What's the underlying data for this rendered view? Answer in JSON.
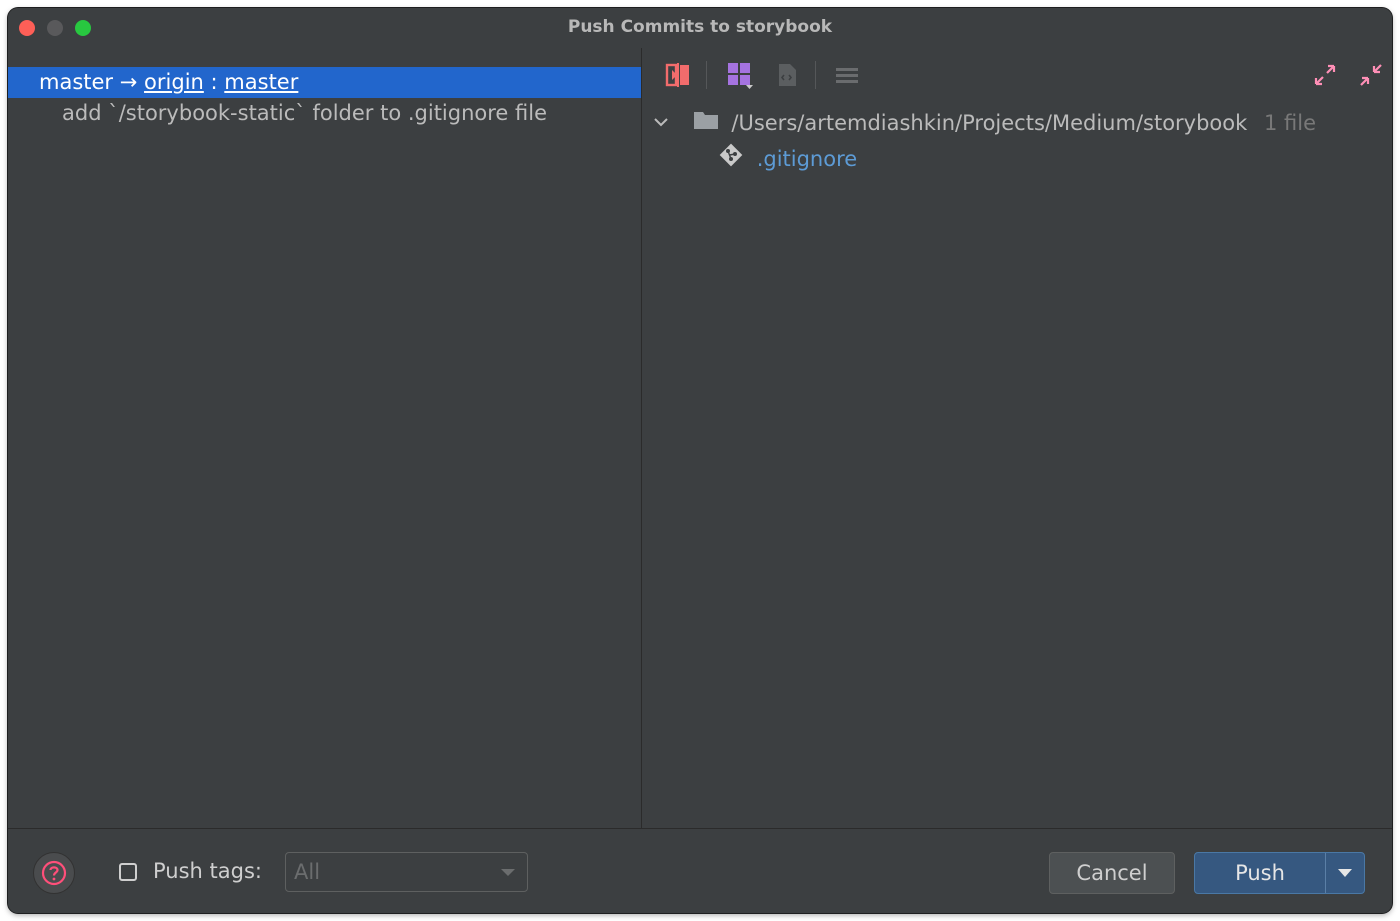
{
  "window": {
    "title": "Push Commits to storybook"
  },
  "branch": {
    "local": "master",
    "arrow": "→",
    "remote": "origin",
    "separator": ":",
    "remote_branch": "master"
  },
  "commits": [
    {
      "message": "add `/storybook-static` folder to .gitignore file"
    }
  ],
  "toolbar": {
    "icons": [
      "show-diff-icon",
      "group-by-icon",
      "edit-source-icon",
      "view-options-icon",
      "expand-all-icon",
      "collapse-all-icon"
    ]
  },
  "changes_tree": {
    "path": "/Users/artemdiashkin/Projects/Medium/storybook",
    "count": "1 file",
    "files": [
      {
        "name": ".gitignore",
        "icon": "git-file-icon"
      }
    ]
  },
  "footer": {
    "help_icon": "help-icon",
    "push_tags_label": "Push tags:",
    "push_tags_checked": false,
    "push_tags_value": "All",
    "cancel_label": "Cancel",
    "push_label": "Push"
  },
  "colors": {
    "selection": "#2266cc",
    "file_link": "#5d9bd5",
    "primary_button": "#365880",
    "accent_red": "#f26c6c",
    "accent_purple": "#a573e0",
    "accent_pink": "#ff8fb6"
  }
}
